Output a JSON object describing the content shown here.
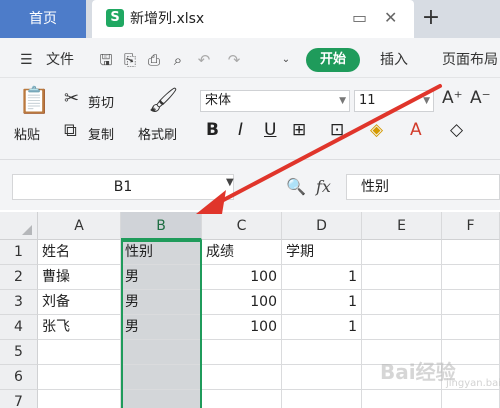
{
  "tabs": {
    "home_label": "首页",
    "file_icon_letter": "S",
    "file_title": "新增列.xlsx",
    "new_tab_symbol": "+"
  },
  "menu": {
    "hamburger_symbol": "☰",
    "file_label": "文件",
    "start_label": "开始",
    "insert_label": "插入",
    "page_layout_label": "页面布局"
  },
  "ribbon": {
    "paste_label": "粘贴",
    "cut_label": "剪切",
    "copy_label": "复制",
    "format_painter_label": "格式刷",
    "font_name": "宋体",
    "font_size": "11",
    "bold_symbol": "B",
    "italic_symbol": "I",
    "underline_symbol": "U",
    "font_color_symbol": "A",
    "grow_font_symbol": "A⁺",
    "shrink_font_symbol": "A⁻"
  },
  "formula_bar": {
    "cell_ref": "B1",
    "fx_symbol": "fx",
    "content": "性别"
  },
  "sheet": {
    "columns": [
      "A",
      "B",
      "C",
      "D",
      "E",
      "F"
    ],
    "rows": [
      "1",
      "2",
      "3",
      "4",
      "5",
      "6",
      "7"
    ],
    "cells": [
      [
        "姓名",
        "性别",
        "成绩",
        "学期",
        "",
        ""
      ],
      [
        "曹操",
        "男",
        "100",
        "1",
        "",
        ""
      ],
      [
        "刘备",
        "男",
        "100",
        "1",
        "",
        ""
      ],
      [
        "张飞",
        "男",
        "100",
        "1",
        "",
        ""
      ],
      [
        "",
        "",
        "",
        "",
        "",
        ""
      ],
      [
        "",
        "",
        "",
        "",
        "",
        ""
      ],
      [
        "",
        "",
        "",
        "",
        "",
        ""
      ]
    ]
  },
  "watermark": {
    "text": "Bai经验",
    "sub": "jingyan.baidu.com"
  },
  "colors": {
    "accent": "#1f9b5b",
    "tab_home": "#4d7cc9",
    "arrow": "#e0352b"
  }
}
